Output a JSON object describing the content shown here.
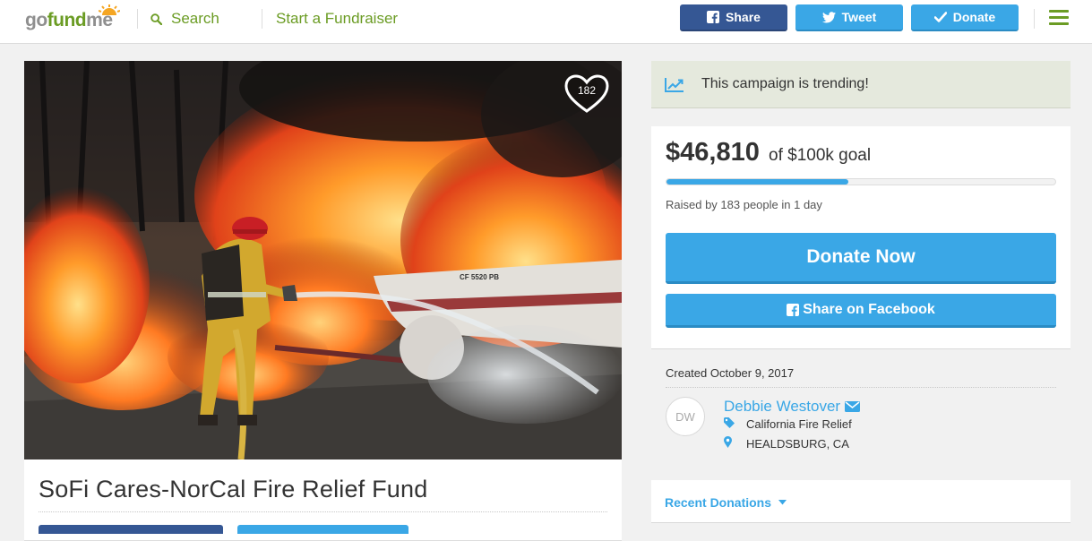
{
  "header": {
    "logo": {
      "go": "go",
      "fund": "fund",
      "me": "me"
    },
    "search_label": "Search",
    "start_label": "Start a Fundraiser",
    "share_label": "Share",
    "tweet_label": "Tweet",
    "donate_label": "Donate"
  },
  "campaign": {
    "title": "SoFi Cares-NorCal Fire Relief Fund",
    "hearts": "182",
    "photo_subject": "firefighter spraying water on a burning boat"
  },
  "trending": {
    "text": "This campaign is trending!"
  },
  "goal": {
    "raised": "$46,810",
    "goal_text": "of $100k goal",
    "progress_fraction": 0.468,
    "raised_by": "Raised by 183 people in 1 day",
    "donate_now": "Donate Now",
    "share_facebook": "Share on Facebook"
  },
  "organizer": {
    "created": "Created October 9, 2017",
    "initials": "DW",
    "name": "Debbie Westover",
    "category": "California Fire Relief",
    "location": "HEALDSBURG, CA"
  },
  "recent": {
    "label": "Recent Donations"
  },
  "colors": {
    "brand_green": "#6b9c24",
    "facebook_blue": "#355794",
    "accent_blue": "#3aa7e6",
    "trending_bg": "#e5e9dd"
  },
  "icons": [
    "search-icon",
    "facebook-icon",
    "twitter-icon",
    "check-icon",
    "menu-icon",
    "heart-icon",
    "trending-icon",
    "envelope-icon",
    "tag-icon",
    "location-pin-icon",
    "caret-down-icon"
  ]
}
